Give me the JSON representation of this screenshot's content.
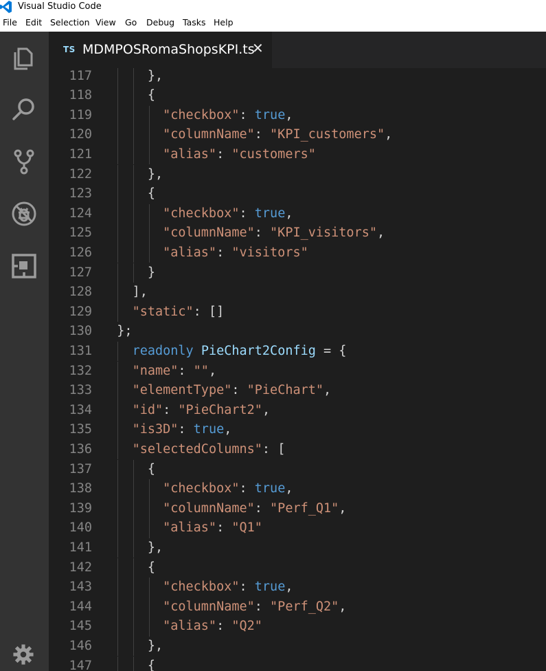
{
  "app": {
    "title": "Visual Studio Code"
  },
  "menu": [
    "File",
    "Edit",
    "Selection",
    "View",
    "Go",
    "Debug",
    "Tasks",
    "Help"
  ],
  "activity": [
    {
      "name": "explorer-icon"
    },
    {
      "name": "search-icon"
    },
    {
      "name": "source-control-icon"
    },
    {
      "name": "debug-icon"
    },
    {
      "name": "extensions-icon"
    },
    {
      "name": "settings-gear-icon"
    }
  ],
  "tab": {
    "lang": "TS",
    "filename": "MDMPOSRomaShopsKPI.ts",
    "close": "✕"
  },
  "editor": {
    "lines": [
      {
        "n": "117",
        "indent": 6,
        "tokens": [
          {
            "t": "},",
            "c": "p"
          }
        ]
      },
      {
        "n": "118",
        "indent": 6,
        "tokens": [
          {
            "t": "{",
            "c": "p"
          }
        ]
      },
      {
        "n": "119",
        "indent": 8,
        "tokens": [
          {
            "t": "\"checkbox\"",
            "c": "s"
          },
          {
            "t": ": ",
            "c": "p"
          },
          {
            "t": "true",
            "c": "b"
          },
          {
            "t": ",",
            "c": "p"
          }
        ]
      },
      {
        "n": "120",
        "indent": 8,
        "tokens": [
          {
            "t": "\"columnName\"",
            "c": "s"
          },
          {
            "t": ": ",
            "c": "p"
          },
          {
            "t": "\"KPI_customers\"",
            "c": "s"
          },
          {
            "t": ",",
            "c": "p"
          }
        ]
      },
      {
        "n": "121",
        "indent": 8,
        "tokens": [
          {
            "t": "\"alias\"",
            "c": "s"
          },
          {
            "t": ": ",
            "c": "p"
          },
          {
            "t": "\"customers\"",
            "c": "s"
          }
        ]
      },
      {
        "n": "122",
        "indent": 6,
        "tokens": [
          {
            "t": "},",
            "c": "p"
          }
        ]
      },
      {
        "n": "123",
        "indent": 6,
        "tokens": [
          {
            "t": "{",
            "c": "p"
          }
        ]
      },
      {
        "n": "124",
        "indent": 8,
        "tokens": [
          {
            "t": "\"checkbox\"",
            "c": "s"
          },
          {
            "t": ": ",
            "c": "p"
          },
          {
            "t": "true",
            "c": "b"
          },
          {
            "t": ",",
            "c": "p"
          }
        ]
      },
      {
        "n": "125",
        "indent": 8,
        "tokens": [
          {
            "t": "\"columnName\"",
            "c": "s"
          },
          {
            "t": ": ",
            "c": "p"
          },
          {
            "t": "\"KPI_visitors\"",
            "c": "s"
          },
          {
            "t": ",",
            "c": "p"
          }
        ]
      },
      {
        "n": "126",
        "indent": 8,
        "tokens": [
          {
            "t": "\"alias\"",
            "c": "s"
          },
          {
            "t": ": ",
            "c": "p"
          },
          {
            "t": "\"visitors\"",
            "c": "s"
          }
        ]
      },
      {
        "n": "127",
        "indent": 6,
        "tokens": [
          {
            "t": "}",
            "c": "p"
          }
        ]
      },
      {
        "n": "128",
        "indent": 4,
        "tokens": [
          {
            "t": "],",
            "c": "p"
          }
        ]
      },
      {
        "n": "129",
        "indent": 4,
        "tokens": [
          {
            "t": "\"static\"",
            "c": "s"
          },
          {
            "t": ": []",
            "c": "p"
          }
        ]
      },
      {
        "n": "130",
        "indent": 2,
        "tokens": [
          {
            "t": "};",
            "c": "p"
          }
        ]
      },
      {
        "n": "131",
        "indent": 4,
        "tokens": [
          {
            "t": "readonly ",
            "c": "b"
          },
          {
            "t": "PieChart2Config",
            "c": "id"
          },
          {
            "t": " = {",
            "c": "p"
          }
        ]
      },
      {
        "n": "132",
        "indent": 4,
        "tokens": [
          {
            "t": "\"name\"",
            "c": "s"
          },
          {
            "t": ": ",
            "c": "p"
          },
          {
            "t": "\"\"",
            "c": "s"
          },
          {
            "t": ",",
            "c": "p"
          }
        ]
      },
      {
        "n": "133",
        "indent": 4,
        "tokens": [
          {
            "t": "\"elementType\"",
            "c": "s"
          },
          {
            "t": ": ",
            "c": "p"
          },
          {
            "t": "\"PieChart\"",
            "c": "s"
          },
          {
            "t": ",",
            "c": "p"
          }
        ]
      },
      {
        "n": "134",
        "indent": 4,
        "tokens": [
          {
            "t": "\"id\"",
            "c": "s"
          },
          {
            "t": ": ",
            "c": "p"
          },
          {
            "t": "\"PieChart2\"",
            "c": "s"
          },
          {
            "t": ",",
            "c": "p"
          }
        ]
      },
      {
        "n": "135",
        "indent": 4,
        "tokens": [
          {
            "t": "\"is3D\"",
            "c": "s"
          },
          {
            "t": ": ",
            "c": "p"
          },
          {
            "t": "true",
            "c": "b"
          },
          {
            "t": ",",
            "c": "p"
          }
        ]
      },
      {
        "n": "136",
        "indent": 4,
        "tokens": [
          {
            "t": "\"selectedColumns\"",
            "c": "s"
          },
          {
            "t": ": [",
            "c": "p"
          }
        ]
      },
      {
        "n": "137",
        "indent": 6,
        "tokens": [
          {
            "t": "{",
            "c": "p"
          }
        ]
      },
      {
        "n": "138",
        "indent": 8,
        "tokens": [
          {
            "t": "\"checkbox\"",
            "c": "s"
          },
          {
            "t": ": ",
            "c": "p"
          },
          {
            "t": "true",
            "c": "b"
          },
          {
            "t": ",",
            "c": "p"
          }
        ]
      },
      {
        "n": "139",
        "indent": 8,
        "tokens": [
          {
            "t": "\"columnName\"",
            "c": "s"
          },
          {
            "t": ": ",
            "c": "p"
          },
          {
            "t": "\"Perf_Q1\"",
            "c": "s"
          },
          {
            "t": ",",
            "c": "p"
          }
        ]
      },
      {
        "n": "140",
        "indent": 8,
        "tokens": [
          {
            "t": "\"alias\"",
            "c": "s"
          },
          {
            "t": ": ",
            "c": "p"
          },
          {
            "t": "\"Q1\"",
            "c": "s"
          }
        ]
      },
      {
        "n": "141",
        "indent": 6,
        "tokens": [
          {
            "t": "},",
            "c": "p"
          }
        ]
      },
      {
        "n": "142",
        "indent": 6,
        "tokens": [
          {
            "t": "{",
            "c": "p"
          }
        ]
      },
      {
        "n": "143",
        "indent": 8,
        "tokens": [
          {
            "t": "\"checkbox\"",
            "c": "s"
          },
          {
            "t": ": ",
            "c": "p"
          },
          {
            "t": "true",
            "c": "b"
          },
          {
            "t": ",",
            "c": "p"
          }
        ]
      },
      {
        "n": "144",
        "indent": 8,
        "tokens": [
          {
            "t": "\"columnName\"",
            "c": "s"
          },
          {
            "t": ": ",
            "c": "p"
          },
          {
            "t": "\"Perf_Q2\"",
            "c": "s"
          },
          {
            "t": ",",
            "c": "p"
          }
        ]
      },
      {
        "n": "145",
        "indent": 8,
        "tokens": [
          {
            "t": "\"alias\"",
            "c": "s"
          },
          {
            "t": ": ",
            "c": "p"
          },
          {
            "t": "\"Q2\"",
            "c": "s"
          }
        ]
      },
      {
        "n": "146",
        "indent": 6,
        "tokens": [
          {
            "t": "},",
            "c": "p"
          }
        ]
      },
      {
        "n": "147",
        "indent": 6,
        "tokens": [
          {
            "t": "{",
            "c": "p"
          }
        ]
      }
    ]
  }
}
